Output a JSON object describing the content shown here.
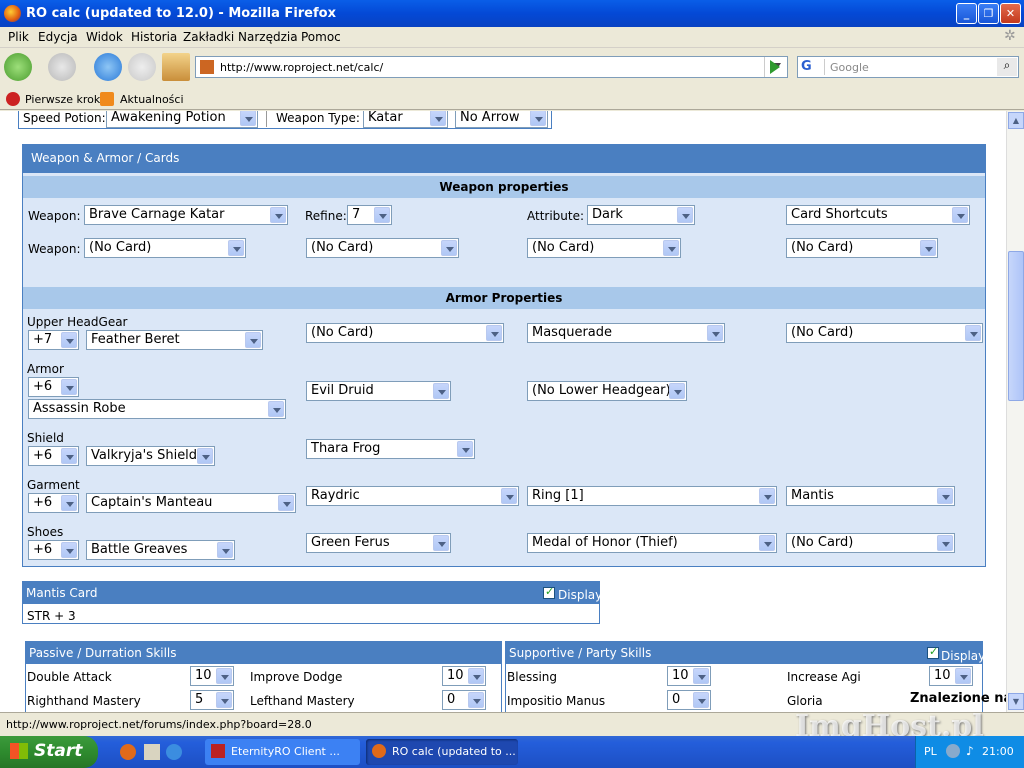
{
  "window": {
    "title": "RO calc (updated to 12.0) - Mozilla Firefox"
  },
  "menu": [
    "Plik",
    "Edycja",
    "Widok",
    "Historia",
    "Zakładki",
    "Narzędzia",
    "Pomoc"
  ],
  "nav": {
    "url": "http://www.roproject.net/calc/",
    "search_placeholder": "Google"
  },
  "bookmarks": [
    "Pierwsze kroki",
    "Aktualności"
  ],
  "top_row": {
    "speed_label": "Speed Potion:",
    "speed_value": "Awakening Potion",
    "weapon_type_label": "Weapon Type:",
    "weapon_type_value": "Katar",
    "arrow_value": "No Arrow"
  },
  "weapon_section": {
    "header": "Weapon & Armor / Cards",
    "weapon_props_title": "Weapon properties",
    "weapon_label": "Weapon:",
    "weapon_value": "Brave Carnage Katar",
    "refine_label": "Refine:",
    "refine_value": "7",
    "attribute_label": "Attribute:",
    "attribute_value": "Dark",
    "card_shortcuts": "Card Shortcuts",
    "weapon2_label": "Weapon:",
    "cards": [
      "(No Card)",
      "(No Card)",
      "(No Card)",
      "(No Card)"
    ]
  },
  "armor_section": {
    "title": "Armor Properties",
    "upper_label": "Upper HeadGear",
    "upper_refine": "+7",
    "upper_item": "Feather Beret",
    "upper_card": "(No Card)",
    "middle": "Masquerade",
    "middle_card": "(No Card)",
    "armor_label": "Armor",
    "armor_refine": "+6",
    "armor_item": "Assassin Robe",
    "armor_card": "Evil Druid",
    "lower": "(No Lower Headgear)",
    "shield_label": "Shield",
    "shield_refine": "+6",
    "shield_item": "Valkryja's Shield",
    "shield_card": "Thara Frog",
    "garment_label": "Garment",
    "garment_refine": "+6",
    "garment_item": "Captain's Manteau",
    "garment_card": "Raydric",
    "acc1": "Ring [1]",
    "acc1_card": "Mantis",
    "shoes_label": "Shoes",
    "shoes_refine": "+6",
    "shoes_item": "Battle Greaves",
    "shoes_card": "Green Ferus",
    "acc2": "Medal of Honor (Thief)",
    "acc2_card": "(No Card)"
  },
  "mantis_card": {
    "title": "Mantis Card",
    "display": "Display",
    "effect": "STR + 3"
  },
  "passive": {
    "title": "Passive / Durration Skills",
    "rows": [
      {
        "a": "Double Attack",
        "av": "10",
        "b": "Improve Dodge",
        "bv": "10"
      },
      {
        "a": "Righthand Mastery",
        "av": "5",
        "b": "Lefthand Mastery",
        "bv": "0"
      }
    ]
  },
  "support": {
    "title": "Supportive / Party Skills",
    "display": "Display",
    "rows": [
      {
        "a": "Blessing",
        "av": "10",
        "b": "Increase Agi",
        "bv": "10"
      },
      {
        "a": "Impositio Manus",
        "av": "0",
        "b": "Gloria",
        "bv": ""
      }
    ]
  },
  "status_url": "http://www.roproject.net/forums/index.php?board=28.0",
  "watermark": "ImgHost.pl",
  "zn": "Znalezione na:",
  "taskbar": {
    "start": "Start",
    "task1": "EternityRO Client ...",
    "task2": "RO calc (updated to ...",
    "lang": "PL",
    "clock": "21:00"
  }
}
